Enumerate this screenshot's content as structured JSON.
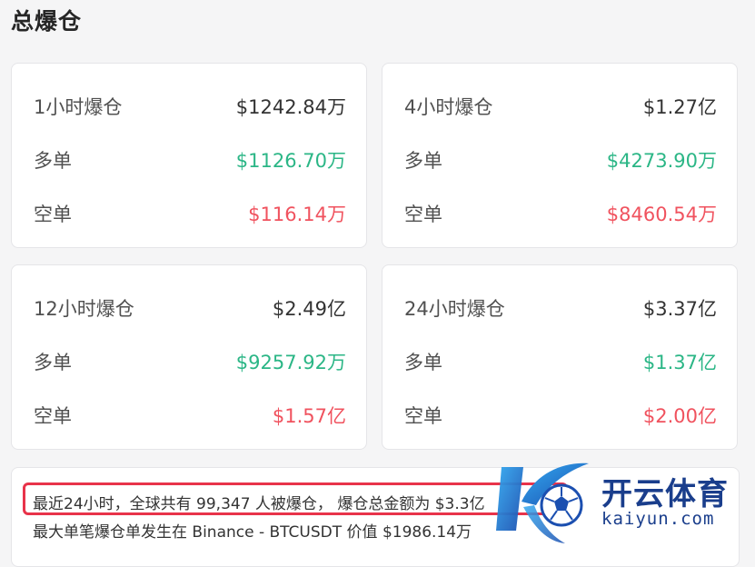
{
  "page": {
    "title": "总爆仓"
  },
  "cards": [
    {
      "total_label": "1小时爆仓",
      "total_value": "$1242.84万",
      "long_label": "多单",
      "long_value": "$1126.70万",
      "short_label": "空单",
      "short_value": "$116.14万"
    },
    {
      "total_label": "4小时爆仓",
      "total_value": "$1.27亿",
      "long_label": "多单",
      "long_value": "$4273.90万",
      "short_label": "空单",
      "short_value": "$8460.54万"
    },
    {
      "total_label": "12小时爆仓",
      "total_value": "$2.49亿",
      "long_label": "多单",
      "long_value": "$9257.92万",
      "short_label": "空单",
      "short_value": "$1.57亿"
    },
    {
      "total_label": "24小时爆仓",
      "total_value": "$3.37亿",
      "long_label": "多单",
      "long_value": "$1.37亿",
      "short_label": "空单",
      "short_value": "$2.00亿"
    }
  ],
  "summary": {
    "line1": "最近24小时，全球共有 99,347 人被爆仓， 爆仓总金额为 $3.3",
    "line1_tail": "亿",
    "line2": "最大单笔爆仓单发生在 Binance - BTCUSDT 价值 $1986.14万"
  },
  "watermark": {
    "brand": "开云体育",
    "domain": "kaiyun.com",
    "icon": "kaiyun-logo-icon"
  },
  "colors": {
    "long": "#2bb686",
    "short": "#f0525e",
    "highlight": "#e8334a",
    "brand": "#1a3e8c"
  }
}
